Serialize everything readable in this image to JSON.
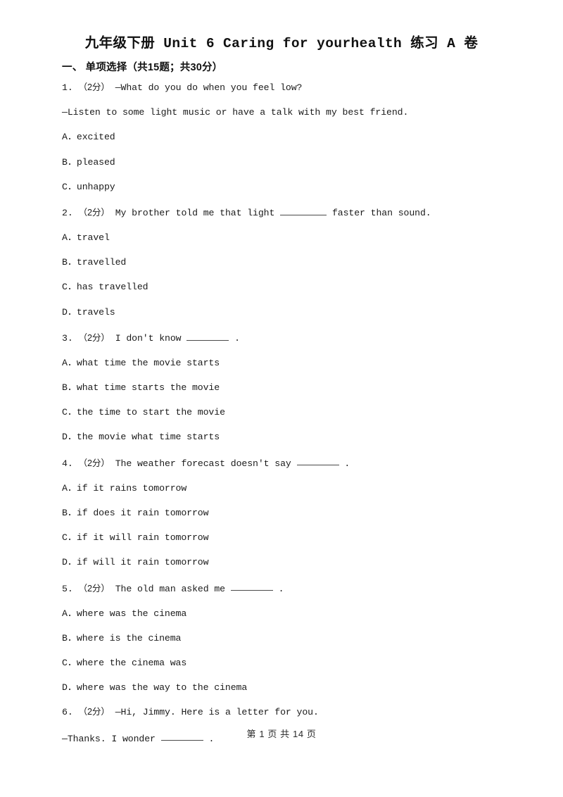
{
  "document": {
    "title": "九年级下册 Unit 6 Caring for yourhealth 练习 A 卷",
    "section_heading": "一、 单项选择（共15题；共30分）",
    "footer": "第 1 页 共 14 页"
  },
  "questions": [
    {
      "number": "1.",
      "points": "（2分）",
      "stem": "—What do you do when you feel low?",
      "continuation": "—Listen to some light music or have a talk with my best friend.",
      "blank": false,
      "options": [
        {
          "letter": "A．",
          "text": "excited"
        },
        {
          "letter": "B．",
          "text": "pleased"
        },
        {
          "letter": "C．",
          "text": "unhappy"
        }
      ]
    },
    {
      "number": "2.",
      "points": "（2分）",
      "stem": "My brother told me that light",
      "stem_after": "faster than sound.",
      "blank": true,
      "blank_size": "blank-md",
      "options": [
        {
          "letter": "A．",
          "text": "travel"
        },
        {
          "letter": "B．",
          "text": "travelled"
        },
        {
          "letter": "C．",
          "text": "has travelled"
        },
        {
          "letter": "D．",
          "text": "travels"
        }
      ]
    },
    {
      "number": "3.",
      "points": "（2分）",
      "stem": "I don't know",
      "stem_after": ".",
      "blank": true,
      "blank_size": "blank-sm",
      "options": [
        {
          "letter": "A．",
          "text": "what time the movie starts"
        },
        {
          "letter": "B．",
          "text": "what time starts the movie"
        },
        {
          "letter": "C．",
          "text": "the time to start the movie"
        },
        {
          "letter": "D．",
          "text": "the movie what time starts"
        }
      ]
    },
    {
      "number": "4.",
      "points": "（2分）",
      "stem": "The weather forecast doesn't say",
      "stem_after": ".",
      "blank": true,
      "blank_size": "blank-sm",
      "options": [
        {
          "letter": "A．",
          "text": "if it rains tomorrow"
        },
        {
          "letter": "B．",
          "text": "if does it rain tomorrow"
        },
        {
          "letter": "C．",
          "text": "if it will rain tomorrow"
        },
        {
          "letter": "D．",
          "text": "if will it rain tomorrow"
        }
      ]
    },
    {
      "number": "5.",
      "points": "（2分）",
      "stem": "The old man asked me",
      "stem_after": ".",
      "blank": true,
      "blank_size": "blank-sm",
      "options": [
        {
          "letter": "A．",
          "text": "where was the cinema"
        },
        {
          "letter": "B．",
          "text": "where is the cinema"
        },
        {
          "letter": "C．",
          "text": "where the cinema was"
        },
        {
          "letter": "D．",
          "text": "where was the way to the cinema"
        }
      ]
    },
    {
      "number": "6.",
      "points": "（2分）",
      "stem": "—Hi, Jimmy. Here is a letter for you.",
      "continuation_pre": "—Thanks. I wonder",
      "continuation_post": ".",
      "continuation_blank": true,
      "blank": false,
      "options": []
    }
  ]
}
